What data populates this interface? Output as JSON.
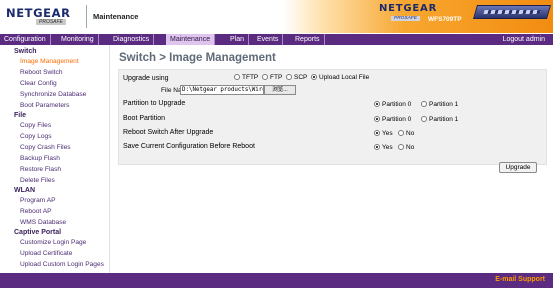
{
  "header": {
    "brand": "NETGEAR",
    "prosafe": "PROSAFE",
    "section_title": "Maintenance",
    "banner_brand": "NETGEAR",
    "banner_prosafe": "PROSAFE",
    "model": "WFS709TP"
  },
  "nav": {
    "items": [
      "Configuration",
      "Monitoring",
      "Diagnostics",
      "Maintenance",
      "Plan",
      "Events",
      "Reports"
    ],
    "active": "Maintenance",
    "logout": "Logout admin"
  },
  "sidebar": {
    "sections": [
      {
        "title": "Switch",
        "items": [
          "Image Management",
          "Reboot Switch",
          "Clear Config",
          "Synchronize Database",
          "Boot Parameters"
        ]
      },
      {
        "title": "File",
        "items": [
          "Copy Files",
          "Copy Logs",
          "Copy Crash Files",
          "Backup Flash",
          "Restore Flash",
          "Delete Files"
        ]
      },
      {
        "title": "WLAN",
        "items": [
          "Program AP",
          "Reboot AP",
          "WMS Database"
        ]
      },
      {
        "title": "Captive Portal",
        "items": [
          "Customize Login Page",
          "Upload Certificate",
          "Upload Custom Login Pages"
        ]
      }
    ],
    "active_item": "Image Management"
  },
  "main": {
    "title": "Switch > Image Management",
    "upgrade_using": {
      "label": "Upgrade using",
      "options": [
        "TFTP",
        "FTP",
        "SCP",
        "Upload Local File"
      ],
      "selected": "Upload Local File"
    },
    "file_name": {
      "label": "File Name",
      "value": "D:\\Netgear products\\Wire",
      "browse_label": "浏览..."
    },
    "partition_to_upgrade": {
      "label": "Partition to Upgrade",
      "options": [
        "Partition 0",
        "Partition 1"
      ],
      "selected": "Partition 0"
    },
    "boot_partition": {
      "label": "Boot Partition",
      "options": [
        "Partition 0",
        "Partition 1"
      ],
      "selected": "Partition 0"
    },
    "reboot_after": {
      "label": "Reboot Switch After Upgrade",
      "options": [
        "Yes",
        "No"
      ],
      "selected": "Yes"
    },
    "save_config": {
      "label": "Save Current Configuration Before Reboot",
      "options": [
        "Yes",
        "No"
      ],
      "selected": "Yes"
    },
    "upgrade_button": "Upgrade"
  },
  "footer": {
    "email_support": "E-mail Support"
  },
  "colors": {
    "nav_bg": "#5a2b80",
    "nav_active_bg": "#dfc5ee",
    "sidebar_active": "#ff6a00",
    "banner_orange": "#f28c10",
    "title_gray": "#5f6b78"
  }
}
